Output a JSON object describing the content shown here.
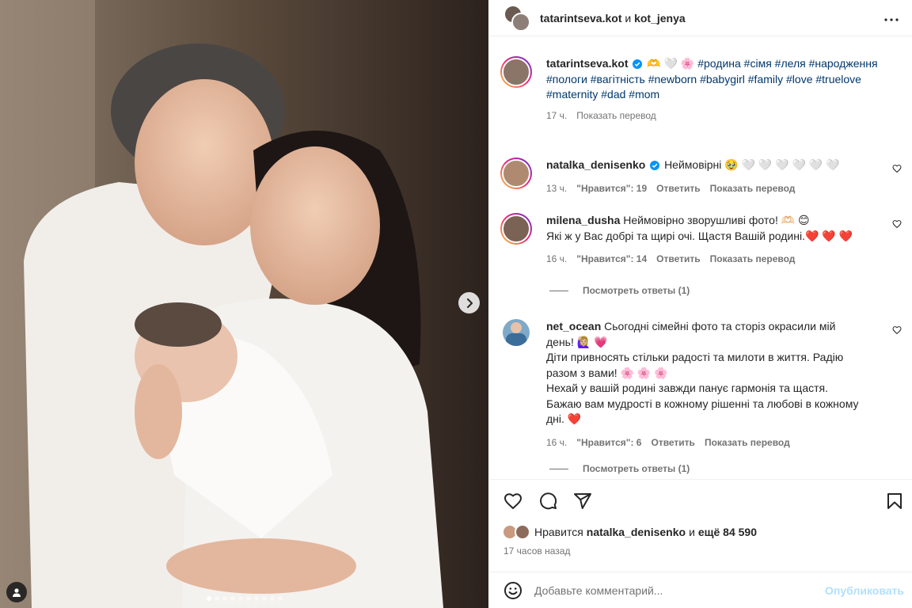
{
  "post": {
    "authors": {
      "first": "tatarintseva.kot",
      "conj": "и",
      "second": "kot_jenya"
    },
    "caption": {
      "username": "tatarintseva.kot",
      "emojis": "🫶 🤍 🌸",
      "hashtags": "#родина #сімя #леля #народження #пологи #вагітність #newborn #babygirl #family #love #truelove #maternity #dad #mom",
      "time": "17 ч.",
      "translate": "Показать перевод"
    },
    "comments": [
      {
        "username": "natalka_denisenko",
        "verified": true,
        "text": "Неймовірні 🥹 🤍 🤍 🤍 🤍 🤍 🤍",
        "time": "13 ч.",
        "likes": "\"Нравится\": 19",
        "reply": "Ответить",
        "translate": "Показать перевод"
      },
      {
        "username": "milena_dusha",
        "text": "Неймовірно зворушливі фото! 🫶🏻 😊",
        "text2": "Які ж у Вас добрі та щирі очі. Щастя Вашій родині.❤️ ❤️ ❤️",
        "time": "16 ч.",
        "likes": "\"Нравится\": 14",
        "reply": "Ответить",
        "translate": "Показать перевод",
        "view_replies": "Посмотреть ответы (1)"
      },
      {
        "username": "net_ocean",
        "text": "Сьогодні сімейні фото та сторіз окрасили мій день! 🙋🏼‍♀️ 💗",
        "text2": "Діти привносять стільки радості та милоти в життя. Радію разом з вами! 🌸 🌸 🌸",
        "text3": "Нехай у вашій родині завжди панує гармонія та щастя. Бажаю вам мудрості в кожному рішенні та любові в кожному дні. ❤️",
        "time": "16 ч.",
        "likes": "\"Нравится\": 6",
        "reply": "Ответить",
        "translate": "Показать перевод",
        "view_replies": "Посмотреть ответы (1)"
      }
    ],
    "likes_line": {
      "prefix": "Нравится",
      "user": "natalka_denisenko",
      "mid": "и",
      "rest": "ещё 84 590"
    },
    "posted": "17 часов назад",
    "add_comment": {
      "placeholder": "Добавьте комментарий...",
      "publish": "Опубликовать"
    },
    "carousel": {
      "count": 10,
      "active": 0
    },
    "colors": {
      "link": "#00376b",
      "muted": "#737373",
      "verified": "#0095f6",
      "publish_disabled": "#b2dffc"
    }
  }
}
